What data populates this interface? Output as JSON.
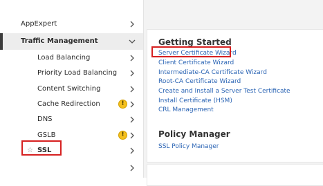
{
  "sidebar": {
    "items": [
      {
        "label": "AppExpert"
      },
      {
        "label": "Traffic Management"
      },
      {
        "label": "Load Balancing"
      },
      {
        "label": "Priority Load Balancing"
      },
      {
        "label": "Content Switching"
      },
      {
        "label": "Cache Redirection",
        "warning": "!"
      },
      {
        "label": "DNS"
      },
      {
        "label": "GSLB",
        "warning": "!"
      },
      {
        "label": "SSL"
      }
    ]
  },
  "main": {
    "getting_started": {
      "title": "Getting Started",
      "links": [
        "Server Certificate Wizard",
        "Client Certificate Wizard",
        "Intermediate-CA Certificate Wizard",
        "Root-CA Certificate Wizard",
        "Create and Install a Server Test Certificate",
        "Install Certificate (HSM)",
        "CRL Management"
      ]
    },
    "policy_manager": {
      "title": "Policy Manager",
      "links": [
        "SSL Policy Manager"
      ]
    }
  },
  "colors": {
    "link": "#2a64b4",
    "highlight_box": "#d62020",
    "warning": "#f4c01e",
    "active_bar": "#3c3c3c"
  }
}
